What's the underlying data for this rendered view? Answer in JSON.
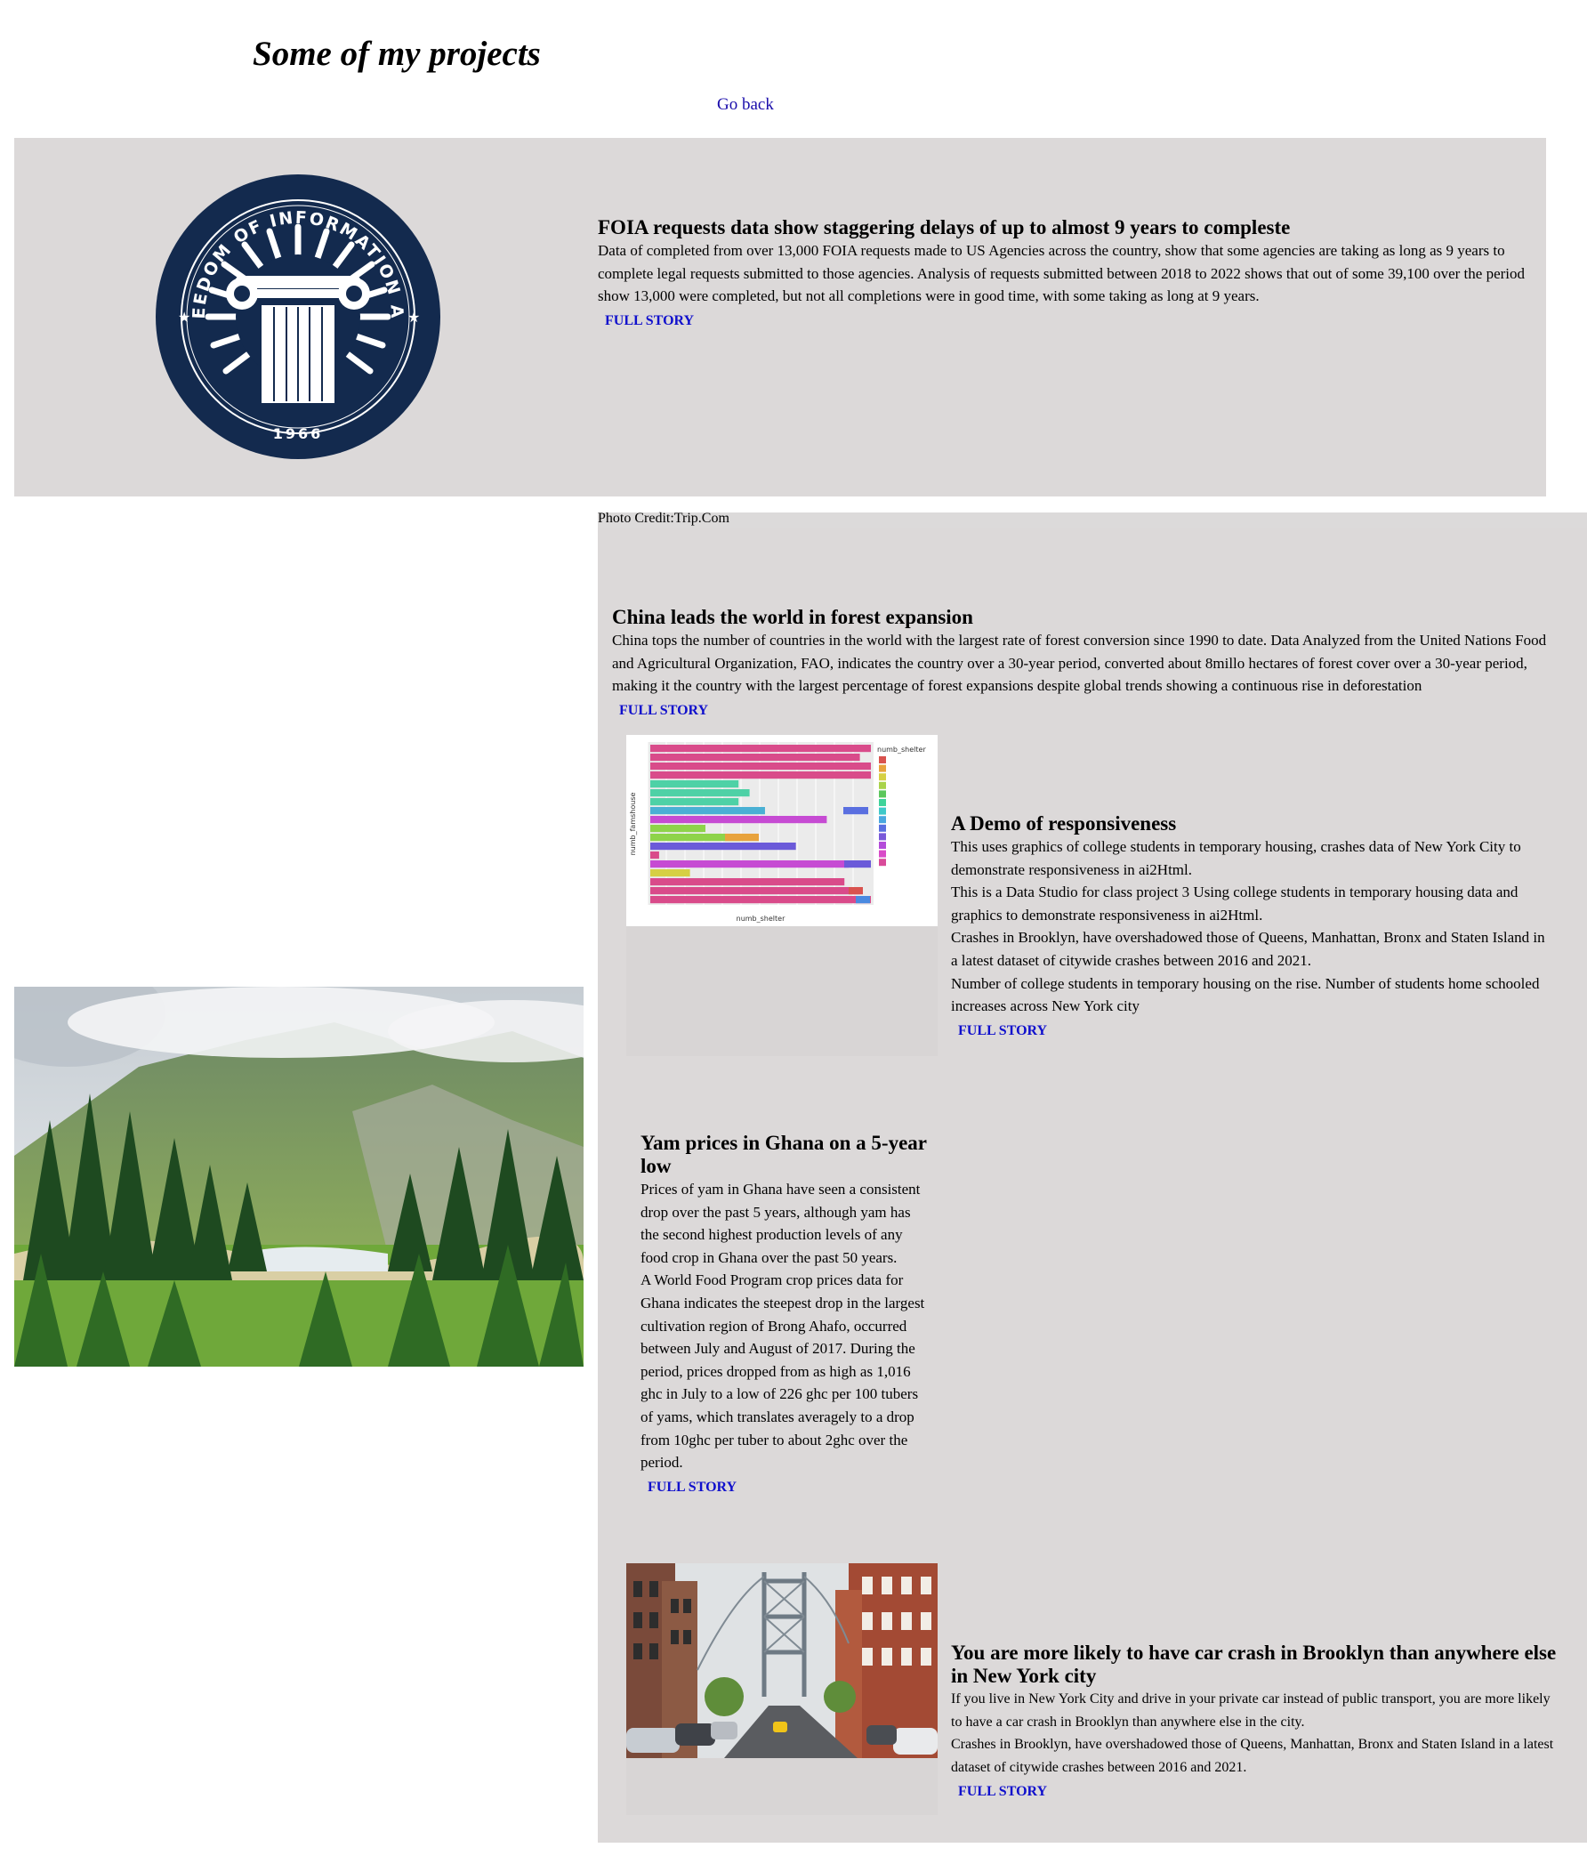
{
  "page": {
    "title": "Some of my projects",
    "go_back": "Go back"
  },
  "foia": {
    "seal_text": "FREEDOM OF INFORMATION ACT",
    "seal_year": "1966",
    "heading": "FOIA requests data show staggering delays of up to almost 9 years to compleste",
    "body": "Data of completed from over 13,000 FOIA requests made to US Agencies across the country, show that some agencies are taking as long as 9 years to complete legal requests submitted to those agencies. Analysis of requests submitted between 2018 to 2022 shows that out of some 39,100 over the period show 13,000 were completed, but not all completions were in good time, with some taking as long at 9 years.",
    "link": "FULL STORY"
  },
  "china": {
    "credit": "Photo Credit:Trip.Com",
    "heading": "China leads the world in forest expansion",
    "body": "China tops the number of countries in the world with the largest rate of forest conversion since 1990 to date. Data Analyzed from the United Nations Food and Agricultural Organization, FAO, indicates the country over a 30-year period, converted about 8millo hectares of forest cover over a 30-year period, making it the country with the largest percentage of forest expansions despite global trends showing a continuous rise in deforestation",
    "link": "FULL STORY"
  },
  "demo": {
    "heading": "A Demo of responsiveness",
    "paragraphs": [
      "This uses graphics of college students in temporary housing, crashes data of New York City to demonstrate responsiveness in ai2Html.",
      "This is a Data Studio for class project 3 Using college students in temporary housing data and graphics to demonstrate responsiveness in ai2Html.",
      "Crashes in Brooklyn, have overshadowed those of Queens, Manhattan, Bronx and Staten Island in a latest dataset of citywide crashes between 2016 and 2021.",
      "Number of college students in temporary housing on the rise. Number of students home schooled increases across New York city"
    ],
    "link": "FULL STORY",
    "thumb": {
      "legend_title": "numb_shelter",
      "xlabel": "numb_shelter",
      "ylabel": "numb_famshouse",
      "legend_colors": [
        "#d9534f",
        "#e8a33d",
        "#d6d044",
        "#a9d34a",
        "#5cc75c",
        "#3fd39a",
        "#3fc9c9",
        "#4aa8e0",
        "#5a6fe0",
        "#7a59d9",
        "#b34bd9",
        "#d94bc8",
        "#d94b9a"
      ]
    }
  },
  "yam": {
    "heading": "Yam prices in Ghana on a 5-year low",
    "paragraphs": [
      "Prices of yam in Ghana have seen a consistent drop over the past 5 years, although yam has the second highest production levels of any food crop in Ghana over the past 50 years.",
      "A World Food Program crop prices data for Ghana indicates the steepest drop in the largest cultivation region of Brong Ahafo, occurred between July and August of 2017. During the period, prices dropped from as high as 1,016 ghc in July to a low of 226 ghc per 100 tubers of yams, which translates averagely to a drop from 10ghc per tuber to about 2ghc over the period."
    ],
    "link": "FULL STORY"
  },
  "brooklyn": {
    "heading": "You are more likely to have car crash in Brooklyn than anywhere else in New York city",
    "paragraphs": [
      "If you live in New York City and drive in your private car instead of public transport, you are more likely to have a car crash in Brooklyn than anywhere else in the city.",
      "Crashes in Brooklyn, have overshadowed those of Queens, Manhattan, Bronx and Staten Island in a latest dataset of citywide crashes between 2016 and 2021."
    ],
    "link": "FULL STORY"
  }
}
